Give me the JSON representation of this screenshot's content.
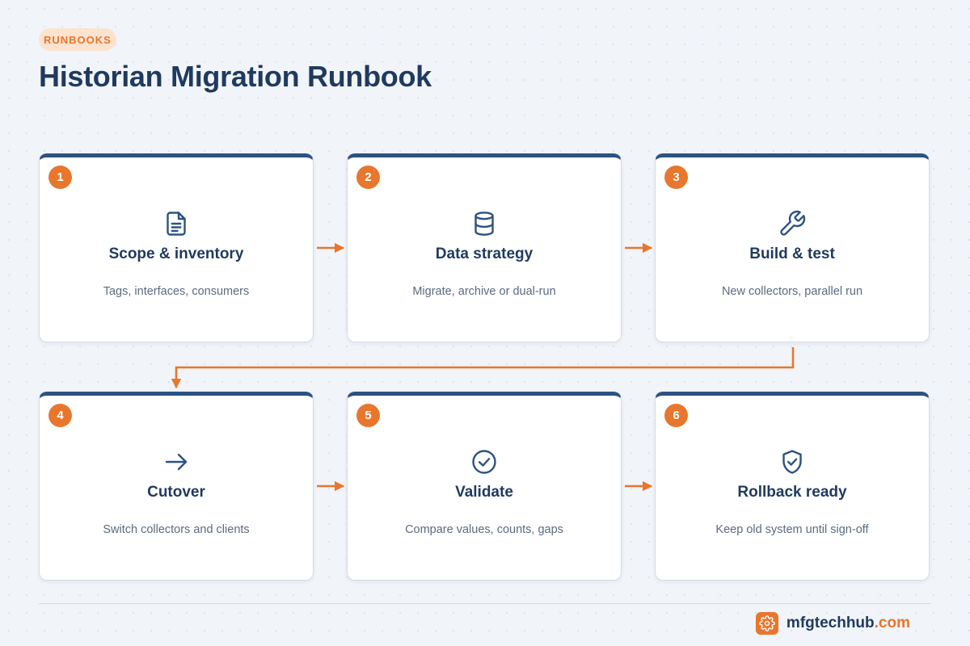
{
  "header": {
    "badge": "RUNBOOKS",
    "title": "Historian Migration Runbook"
  },
  "colors": {
    "accent": "#e8762d",
    "primary": "#1f3a5f",
    "card_top_border": "#2c5282",
    "muted_text": "#5a6b80"
  },
  "steps": [
    {
      "number": "1",
      "icon": "document-icon",
      "title": "Scope & inventory",
      "description": "Tags, interfaces, consumers"
    },
    {
      "number": "2",
      "icon": "database-icon",
      "title": "Data strategy",
      "description": "Migrate, archive or dual-run"
    },
    {
      "number": "3",
      "icon": "wrench-icon",
      "title": "Build & test",
      "description": "New collectors, parallel run"
    },
    {
      "number": "4",
      "icon": "arrow-right-icon",
      "title": "Cutover",
      "description": "Switch collectors and clients"
    },
    {
      "number": "5",
      "icon": "check-circle-icon",
      "title": "Validate",
      "description": "Compare values, counts, gaps"
    },
    {
      "number": "6",
      "icon": "shield-check-icon",
      "title": "Rollback ready",
      "description": "Keep old system until sign-off"
    }
  ],
  "footer": {
    "logo_icon": "gear-icon",
    "brand_main": "mfgtechhub",
    "brand_tld": ".com"
  }
}
